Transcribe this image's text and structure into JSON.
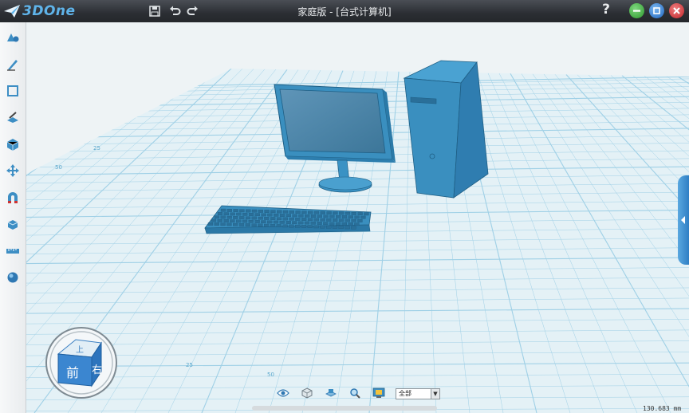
{
  "app": {
    "logo_text": "3DOne",
    "window_title": "家庭版 - [台式计算机]",
    "help_label": "?"
  },
  "quick_access": [
    "save-icon",
    "undo-icon",
    "redo-icon"
  ],
  "window_controls": [
    {
      "name": "minimize-button",
      "color": "#3fae3f"
    },
    {
      "name": "restore-button",
      "color": "#2f7fd6"
    },
    {
      "name": "close-button",
      "color": "#d8363a"
    }
  ],
  "left_toolbar": [
    "basic-solid-icon",
    "sketch-icon",
    "sketch-edit-icon",
    "feature-icon",
    "special-feature-icon",
    "basic-edit-icon",
    "combine-icon",
    "group-icon",
    "measure-icon",
    "render-icon"
  ],
  "view_cube": {
    "top_label": "上",
    "front_label": "前",
    "right_label": "右"
  },
  "grid_labels": [
    "25",
    "50",
    "25",
    "50"
  ],
  "bottom_toolbar": [
    "view-icon",
    "display-mode-icon",
    "view-plane-icon",
    "zoom-icon",
    "render-mode-icon"
  ],
  "filter_select": {
    "value": "全部"
  },
  "coordinate_readout": "130.683 mm",
  "colors": {
    "accent": "#3d8ec4",
    "model_fill": "#3a92c4",
    "grid_line": "#8fc9e3",
    "titlebar": "#2b2e33"
  }
}
